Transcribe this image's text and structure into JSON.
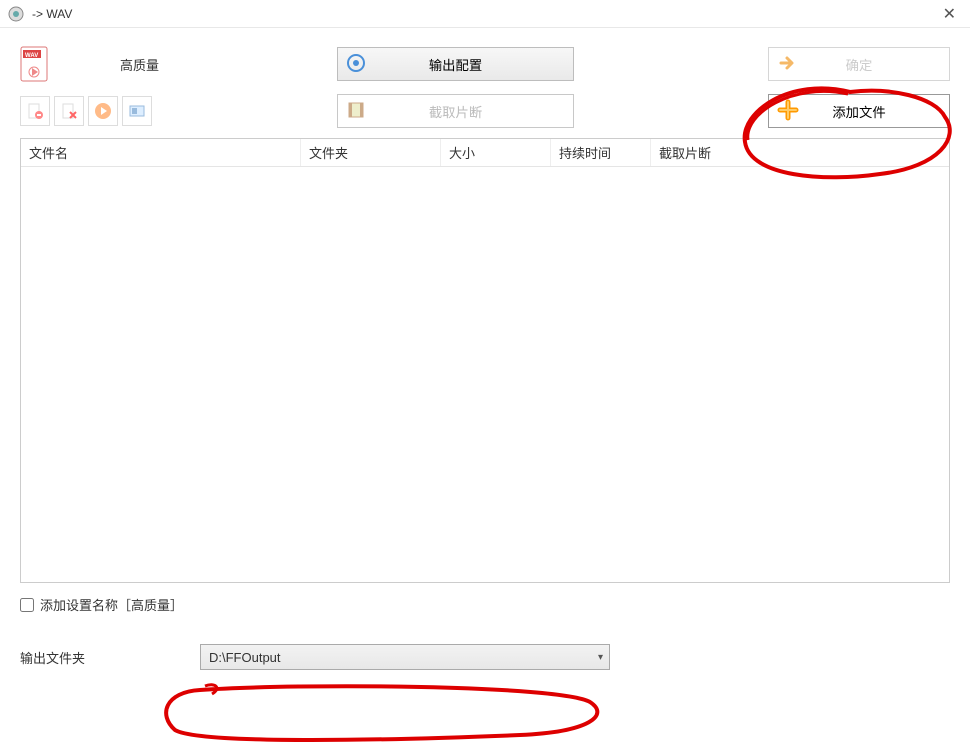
{
  "window": {
    "title": " -> WAV"
  },
  "top": {
    "quality_label": "高质量",
    "output_config": "输出配置",
    "ok": "确定"
  },
  "second": {
    "clip": "截取片断",
    "add_file": "添加文件"
  },
  "table": {
    "headers": {
      "name": "文件名",
      "folder": "文件夹",
      "size": "大小",
      "duration": "持续时间",
      "clip": "截取片断"
    }
  },
  "bottom": {
    "checkbox_label": "添加设置名称［高质量］",
    "output_folder_label": "输出文件夹",
    "output_folder_value": "D:\\FFOutput"
  }
}
